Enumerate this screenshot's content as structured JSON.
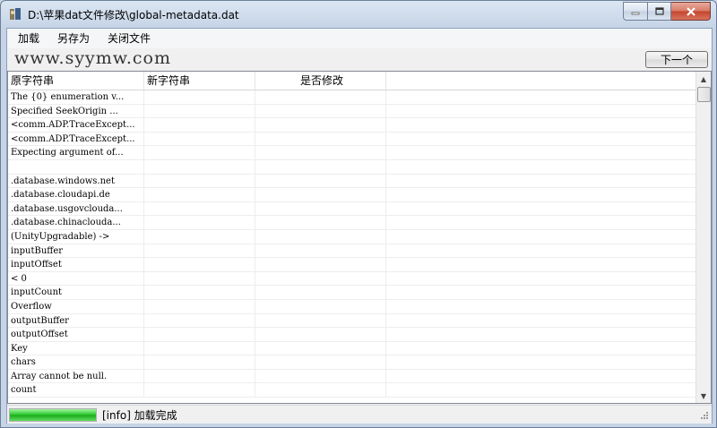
{
  "window": {
    "title": "D:\\苹果dat文件修改\\global-metadata.dat",
    "icons": {
      "app": "app-icon",
      "minimize": "minimize-icon",
      "maximize": "maximize-icon",
      "close": "close-icon"
    }
  },
  "menu": {
    "items": [
      "加载",
      "另存为",
      "关闭文件"
    ]
  },
  "toolbar": {
    "watermark": "www.syymw.com",
    "next_label": "下一个"
  },
  "table": {
    "columns": [
      "原字符串",
      "新字符串",
      "是否修改",
      ""
    ],
    "rows": [
      [
        "The {0} enumeration v...",
        "",
        ""
      ],
      [
        "Specified SeekOrigin ...",
        "",
        ""
      ],
      [
        "<comm.ADP.TraceExcept...",
        "",
        ""
      ],
      [
        "<comm.ADP.TraceExcept...",
        "",
        ""
      ],
      [
        "Expecting argument of...",
        "",
        ""
      ],
      [
        "",
        "",
        ""
      ],
      [
        ".database.windows.net",
        "",
        ""
      ],
      [
        ".database.cloudapi.de",
        "",
        ""
      ],
      [
        ".database.usgovclouda...",
        "",
        ""
      ],
      [
        ".database.chinaclouda...",
        "",
        ""
      ],
      [
        "(UnityUpgradable) ->",
        "",
        ""
      ],
      [
        "inputBuffer",
        "",
        ""
      ],
      [
        "inputOffset",
        "",
        ""
      ],
      [
        "< 0",
        "",
        ""
      ],
      [
        "inputCount",
        "",
        ""
      ],
      [
        "Overflow",
        "",
        ""
      ],
      [
        "outputBuffer",
        "",
        ""
      ],
      [
        "outputOffset",
        "",
        ""
      ],
      [
        "Key",
        "",
        ""
      ],
      [
        "chars",
        "",
        ""
      ],
      [
        "Array cannot be null.",
        "",
        ""
      ],
      [
        "count",
        "",
        ""
      ]
    ]
  },
  "status": {
    "progress": 1.0,
    "progress_color": "#26c426",
    "text": "[info] 加载完成"
  }
}
